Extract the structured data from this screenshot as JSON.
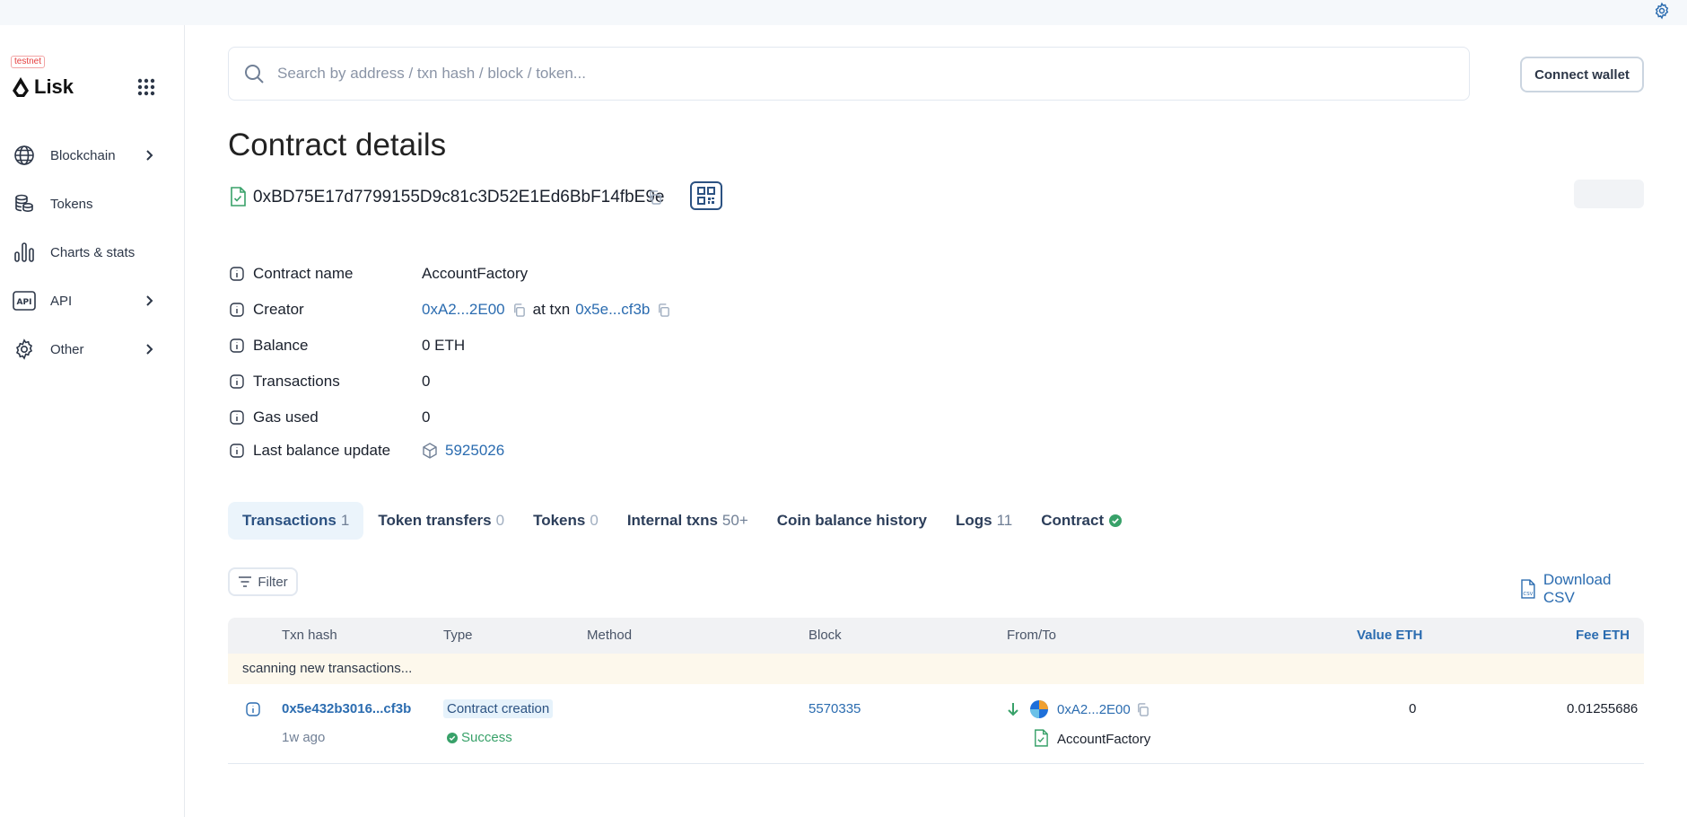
{
  "sidebar": {
    "env_badge": "testnet",
    "logo_text": "Lisk",
    "items": [
      {
        "label": "Blockchain",
        "icon": "globe-icon",
        "has_chevron": true
      },
      {
        "label": "Tokens",
        "icon": "coins-icon",
        "has_chevron": false
      },
      {
        "label": "Charts & stats",
        "icon": "bar-chart-icon",
        "has_chevron": false
      },
      {
        "label": "API",
        "icon": "api-icon",
        "has_chevron": true
      },
      {
        "label": "Other",
        "icon": "gear-icon",
        "has_chevron": true
      }
    ]
  },
  "header": {
    "search_placeholder": "Search by address / txn hash / block / token...",
    "connect_label": "Connect wallet"
  },
  "page": {
    "title": "Contract details",
    "address": "0xBD75E17d7799155D9c81c3D52E1Ed6BbF14fbE9e"
  },
  "details": {
    "contract_name": {
      "label": "Contract name",
      "value": "AccountFactory"
    },
    "creator": {
      "label": "Creator",
      "address": "0xA2...2E00",
      "at_txn_text": "at txn",
      "txn": "0x5e...cf3b"
    },
    "balance": {
      "label": "Balance",
      "value": "0 ETH"
    },
    "transactions": {
      "label": "Transactions",
      "value": "0"
    },
    "gas_used": {
      "label": "Gas used",
      "value": "0"
    },
    "last_balance_update": {
      "label": "Last balance update",
      "value": "5925026"
    }
  },
  "tabs": [
    {
      "label": "Transactions",
      "count": "1"
    },
    {
      "label": "Token transfers",
      "count": "0"
    },
    {
      "label": "Tokens",
      "count": "0"
    },
    {
      "label": "Internal txns",
      "count": "50+"
    },
    {
      "label": "Coin balance history",
      "count": ""
    },
    {
      "label": "Logs",
      "count": "11"
    },
    {
      "label": "Contract",
      "count": ""
    }
  ],
  "toolbar": {
    "filter_label": "Filter",
    "download_label": "Download CSV"
  },
  "table": {
    "columns": [
      "Txn hash",
      "Type",
      "Method",
      "Block",
      "From/To",
      "Value ETH",
      "Fee ETH"
    ],
    "scanning_text": "scanning new transactions...",
    "rows": [
      {
        "hash": "0x5e432b3016...cf3b",
        "age": "1w ago",
        "type": "Contract creation",
        "status": "Success",
        "method": "",
        "block": "5570335",
        "from": "0xA2...2E00",
        "to": "AccountFactory",
        "value": "0",
        "fee": "0.01255686"
      }
    ]
  },
  "colors": {
    "link": "#2b6cb0",
    "success": "#38a169",
    "tab_active_bg": "#ebf4fb",
    "scan_bg": "#fdf8ec"
  }
}
